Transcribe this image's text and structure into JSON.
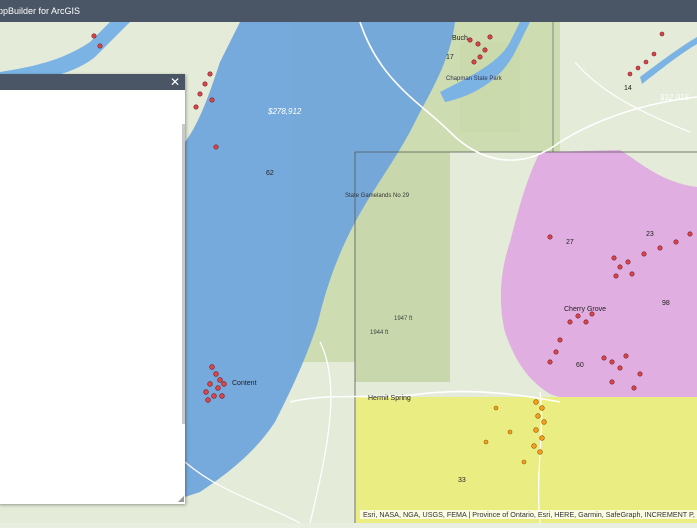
{
  "app": {
    "title": "ppBuilder for ArcGIS"
  },
  "panel": {
    "close_icon": "close-icon"
  },
  "attribution": "Esri, NASA, NGA, USGS, FEMA | Province of Ontario, Esri, HERE, Garmin, SafeGraph, INCREMENT P, ME",
  "map_labels": {
    "price_blue": "$278,912",
    "price_topright": "$12,915",
    "content": "Content",
    "chapman": "Chapman State Park",
    "buch": "Buch",
    "gamelands": "State Gamelands No 29",
    "hermit": "Hermit Spring",
    "cherry": "Cherry Grove",
    "route_62": "62",
    "route_27": "27",
    "route_23": "23",
    "route_98": "98",
    "route_33": "33",
    "route_60": "60",
    "route_14": "14",
    "route_17": "17",
    "elev_1944": "1944 ft",
    "elev_1947": "1947 ft"
  },
  "colors": {
    "blue_region": "#6ea4dc",
    "pink_region": "#e0aee0",
    "yellow_region": "#eaee82",
    "green_forest": "#c5d6a6",
    "points_red": "#d9454c",
    "points_orange": "#f0a020"
  }
}
